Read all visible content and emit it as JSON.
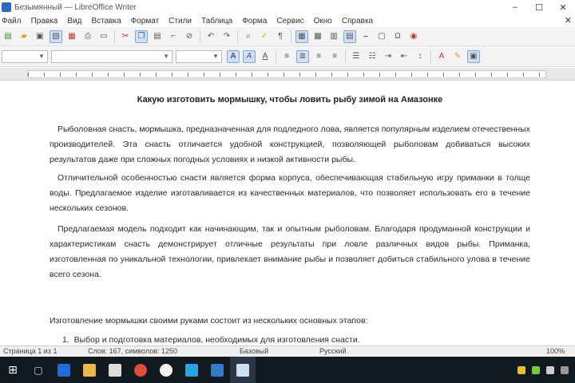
{
  "window": {
    "title": "Безымянный — LibreOffice Writer"
  },
  "menu": {
    "items": [
      "Файл",
      "Правка",
      "Вид",
      "Вставка",
      "Формат",
      "Стили",
      "Таблица",
      "Форма",
      "Сервис",
      "Окно",
      "Справка"
    ]
  },
  "formatting": {
    "style": "",
    "font": "",
    "size": ""
  },
  "document": {
    "title": "Какую изготовить мормышку, чтобы ловить рыбу зимой на Амазонке",
    "paragraphs": [
      "Рыболовная снасть, мормышка, предназначенная для подледного лова, является популярным изделием отечественных производителей. Эта снасть отличается удобной конструкцией, позволяющей рыболовам добиваться высоких результатов даже при сложных погодных условиях и низкой активности рыбы.",
      "Отличительной особенностью снасти является форма корпуса, обеспечивающая стабильную игру приманки в толще воды. Предлагаемое изделие изготавливается из качественных материалов, что позволяет использовать его в течение нескольких сезонов.",
      "Предлагаемая модель подходит как начинающим, так и опытным рыболовам. Благодаря продуманной конструкции и характеристикам снасть демонстрирует отличные результаты при ловле различных видов рыбы. Приманка, изготовленная по уникальной технологии, привлекает внимание рыбы и позволяет добиться стабильного улова в течение всего сезона."
    ],
    "intro_line": "Изготовление мормышки своими руками состоит из нескольких основных этапов:",
    "list": [
      "Выбор и подготовка материалов, необходимых для изготовления снасти."
    ]
  },
  "statusbar": {
    "page": "Страница 1 из 1",
    "words": "Слов: 167, символов: 1250",
    "style": "Базовый",
    "language": "Русский",
    "zoom": "100%"
  },
  "taskbar": {
    "icons": [
      "start-icon",
      "search-icon",
      "edge-icon",
      "explorer-icon",
      "store-icon",
      "chrome-icon",
      "yandex-icon",
      "skype-icon",
      "writer-icon",
      "document-icon"
    ]
  }
}
